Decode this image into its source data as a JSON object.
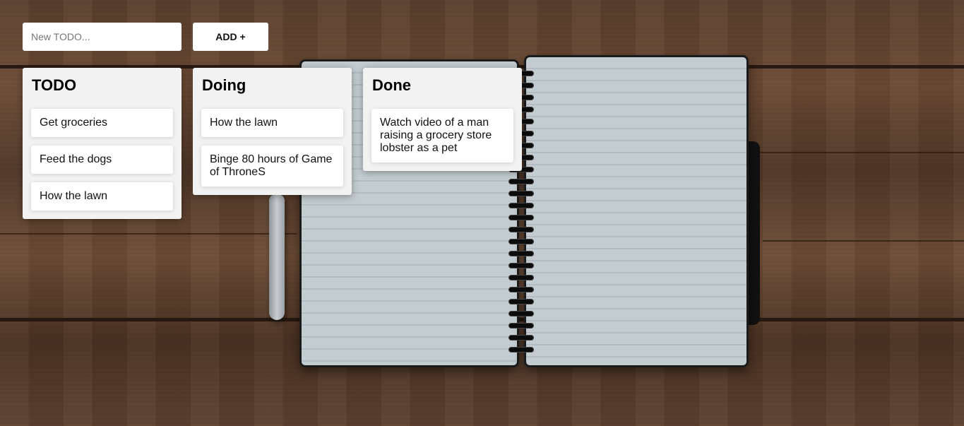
{
  "toolbar": {
    "input_placeholder": "New TODO...",
    "input_value": "",
    "add_label": "ADD +"
  },
  "columns": [
    {
      "title": "TODO",
      "cards": [
        "Get groceries",
        "Feed the dogs",
        "How the lawn"
      ]
    },
    {
      "title": "Doing",
      "cards": [
        "How the lawn",
        "Binge 80 hours of Game of ThroneS"
      ]
    },
    {
      "title": "Done",
      "cards": [
        "Watch video of a man raising a grocery store lobster as a pet"
      ]
    }
  ],
  "colors": {
    "column_bg": "#f2f2f2",
    "card_bg": "#ffffff",
    "wood": "#5a3f2d"
  }
}
